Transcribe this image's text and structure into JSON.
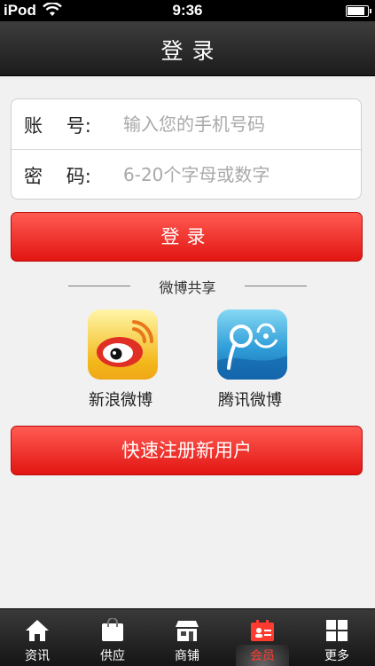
{
  "status_bar": {
    "carrier": "iPod",
    "time": "9:36"
  },
  "nav": {
    "title": "登录"
  },
  "form": {
    "account_label": "账    号:",
    "account_placeholder": "输入您的手机号码",
    "password_label": "密    码:",
    "password_placeholder": "6-20个字母或数字"
  },
  "login_button": "登录",
  "share": {
    "title": "微博共享",
    "apps": [
      {
        "label": "新浪微博",
        "icon": "sina-weibo-icon"
      },
      {
        "label": "腾讯微博",
        "icon": "tencent-weibo-icon"
      }
    ]
  },
  "register_button": "快速注册新用户",
  "tabs": [
    {
      "label": "资讯",
      "icon": "home-icon"
    },
    {
      "label": "供应",
      "icon": "bag-icon"
    },
    {
      "label": "商铺",
      "icon": "store-icon"
    },
    {
      "label": "会员",
      "icon": "member-card-icon",
      "active": true
    },
    {
      "label": "更多",
      "icon": "grid-icon"
    }
  ],
  "colors": {
    "accent": "#e8231e",
    "tab_active": "#ff3b30"
  }
}
